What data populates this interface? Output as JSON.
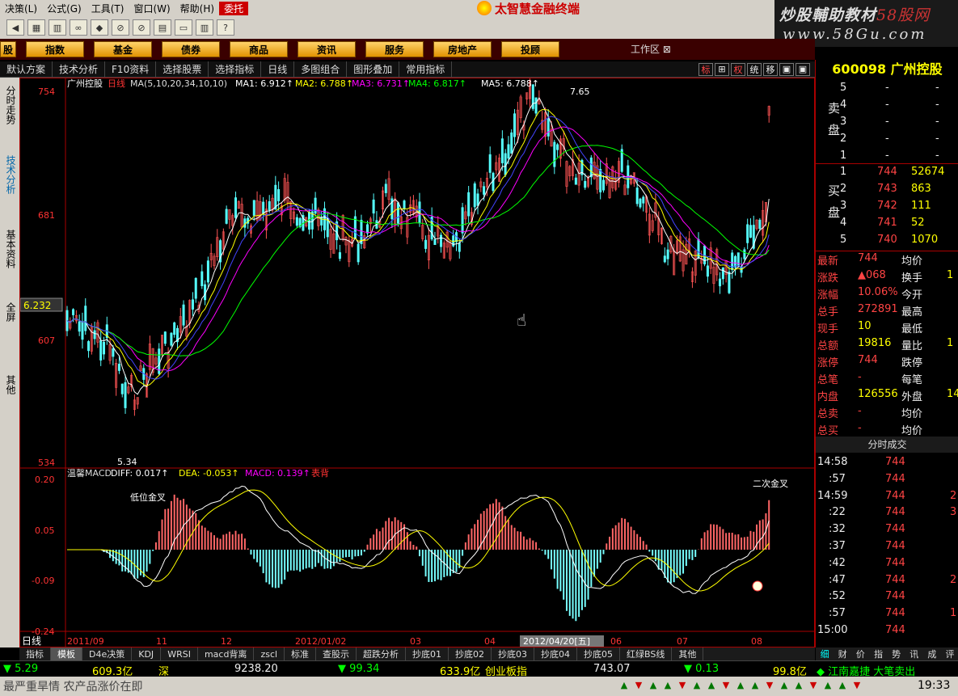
{
  "menu": {
    "items": [
      "决策(L)",
      "公式(G)",
      "工具(T)",
      "窗口(W)",
      "帮助(H)",
      "委托"
    ]
  },
  "brand": {
    "title": "太智慧金融终端"
  },
  "watermark": {
    "line1": "炒股輔助教材",
    "line1_red": "58股网",
    "line2": "www.58Gu.com"
  },
  "categories": [
    "股",
    "指数",
    "基金",
    "债券",
    "商品",
    "资讯",
    "服务",
    "房地产",
    "投顾"
  ],
  "workzone": "工作区",
  "funcbar": {
    "items": [
      "默认方案",
      "技术分析",
      "F10资料",
      "选择股票",
      "选择指标",
      "日线",
      "多图组合",
      "图形叠加",
      "常用指标"
    ],
    "right": [
      "标",
      "⊞",
      "权",
      "统",
      "移",
      "▣",
      "▣"
    ]
  },
  "lefttabs": [
    "分时走势",
    "技术分析",
    "基本资料",
    "全屏",
    "其他"
  ],
  "chart": {
    "stock_label": "广州控股",
    "period": "日线",
    "ma_params": "MA(5,10,20,34,10,10)",
    "ma": [
      {
        "name": "MA1:",
        "val": "6.912↑",
        "color": "#ffffff"
      },
      {
        "name": "MA2:",
        "val": "6.788↑",
        "color": "#ffff00"
      },
      {
        "name": "MA3:",
        "val": "6.731↑",
        "color": "#ff00ff"
      },
      {
        "name": "MA4:",
        "val": "6.817↑",
        "color": "#00ff00"
      },
      {
        "name": "MA5:",
        "val": "6.788↑",
        "color": "#ffffff"
      }
    ],
    "price_ticks": [
      "754",
      "681",
      "607",
      "534"
    ],
    "price_cursor": "6.232",
    "high_label": "7.65",
    "low_label": "5.34",
    "macd_title": "温馨MACD",
    "diff": "DIFF: 0.017↑",
    "dea": "DEA: -0.053↑",
    "macd": "MACD: 0.139↑",
    "flag": "表背",
    "macd_ticks": [
      "0.20",
      "0.05",
      "-0.09",
      "-0.24"
    ],
    "ann_low": "低位金叉",
    "ann_second": "二次金叉",
    "xaxis": [
      "日线",
      "2011/09",
      "11",
      "12",
      "2012/01/02",
      "03",
      "04",
      "2012/04/20[五]",
      "06",
      "07",
      "08"
    ]
  },
  "chart_data": {
    "type": "candlestick",
    "ylim": [
      5.34,
      7.54
    ],
    "macd_ylim": [
      -0.24,
      0.2
    ]
  },
  "bottomtabs": [
    "指标",
    "模板",
    "D4e决策",
    "KDJ",
    "WRSI",
    "macd背离",
    "zscl",
    "标准",
    "查股示",
    "超跌分析",
    "抄底01",
    "抄底02",
    "抄底03",
    "抄底04",
    "抄底05",
    "红绿BS线",
    "其他"
  ],
  "indexbar": {
    "a1": "5.29",
    "a2": "609.3亿",
    "a3": "深",
    "a4": "9238.20",
    "a5": "99.34",
    "a6": "633.9亿",
    "a7": "创业板指",
    "a8": "743.07",
    "a9": "0.13",
    "a10": "99.8亿",
    "a11": "江南嘉捷 大笔卖出"
  },
  "news": "最严重旱情 农产品涨价在即",
  "clock": "19:33",
  "quote": {
    "code": "600098",
    "name": "广州控股",
    "sell_label": "卖盘",
    "buy_label": "买盘",
    "sell": [
      {
        "n": "5",
        "p": "-",
        "v": "-"
      },
      {
        "n": "4",
        "p": "-",
        "v": "-"
      },
      {
        "n": "3",
        "p": "-",
        "v": "-"
      },
      {
        "n": "2",
        "p": "-",
        "v": "-"
      },
      {
        "n": "1",
        "p": "-",
        "v": "-"
      }
    ],
    "buy": [
      {
        "n": "1",
        "p": "744",
        "v": "52674"
      },
      {
        "n": "2",
        "p": "743",
        "v": "863"
      },
      {
        "n": "3",
        "p": "742",
        "v": "111"
      },
      {
        "n": "4",
        "p": "741",
        "v": "52"
      },
      {
        "n": "5",
        "p": "740",
        "v": "1070"
      }
    ],
    "stats": [
      [
        "最新",
        "744",
        "均价",
        ""
      ],
      [
        "涨跌",
        "▲068",
        "换手",
        "1"
      ],
      [
        "涨幅",
        "10.06%",
        "今开",
        ""
      ],
      [
        "总手",
        "272891",
        "最高",
        ""
      ],
      [
        "现手",
        "10",
        "最低",
        ""
      ],
      [
        "总额",
        "19816",
        "量比",
        "1"
      ],
      [
        "涨停",
        "744",
        "跌停",
        ""
      ],
      [
        "总笔",
        "-",
        "每笔",
        ""
      ],
      [
        "内盘",
        "126556",
        "外盘",
        "14"
      ],
      [
        "总卖",
        "-",
        "均价",
        ""
      ],
      [
        "总买",
        "-",
        "均价",
        ""
      ]
    ],
    "ticks_title": "分时成交",
    "ticks": [
      [
        "14:58",
        "744",
        ""
      ],
      [
        ":57",
        "744",
        ""
      ],
      [
        "14:59",
        "744",
        "2"
      ],
      [
        ":22",
        "744",
        "3"
      ],
      [
        ":32",
        "744",
        ""
      ],
      [
        ":37",
        "744",
        ""
      ],
      [
        ":42",
        "744",
        ""
      ],
      [
        ":47",
        "744",
        "2"
      ],
      [
        ":52",
        "744",
        ""
      ],
      [
        ":57",
        "744",
        "1"
      ],
      [
        "15:00",
        "744",
        ""
      ]
    ],
    "tabs": [
      "细",
      "财",
      "价",
      "指",
      "势",
      "讯",
      "成",
      "评"
    ]
  }
}
